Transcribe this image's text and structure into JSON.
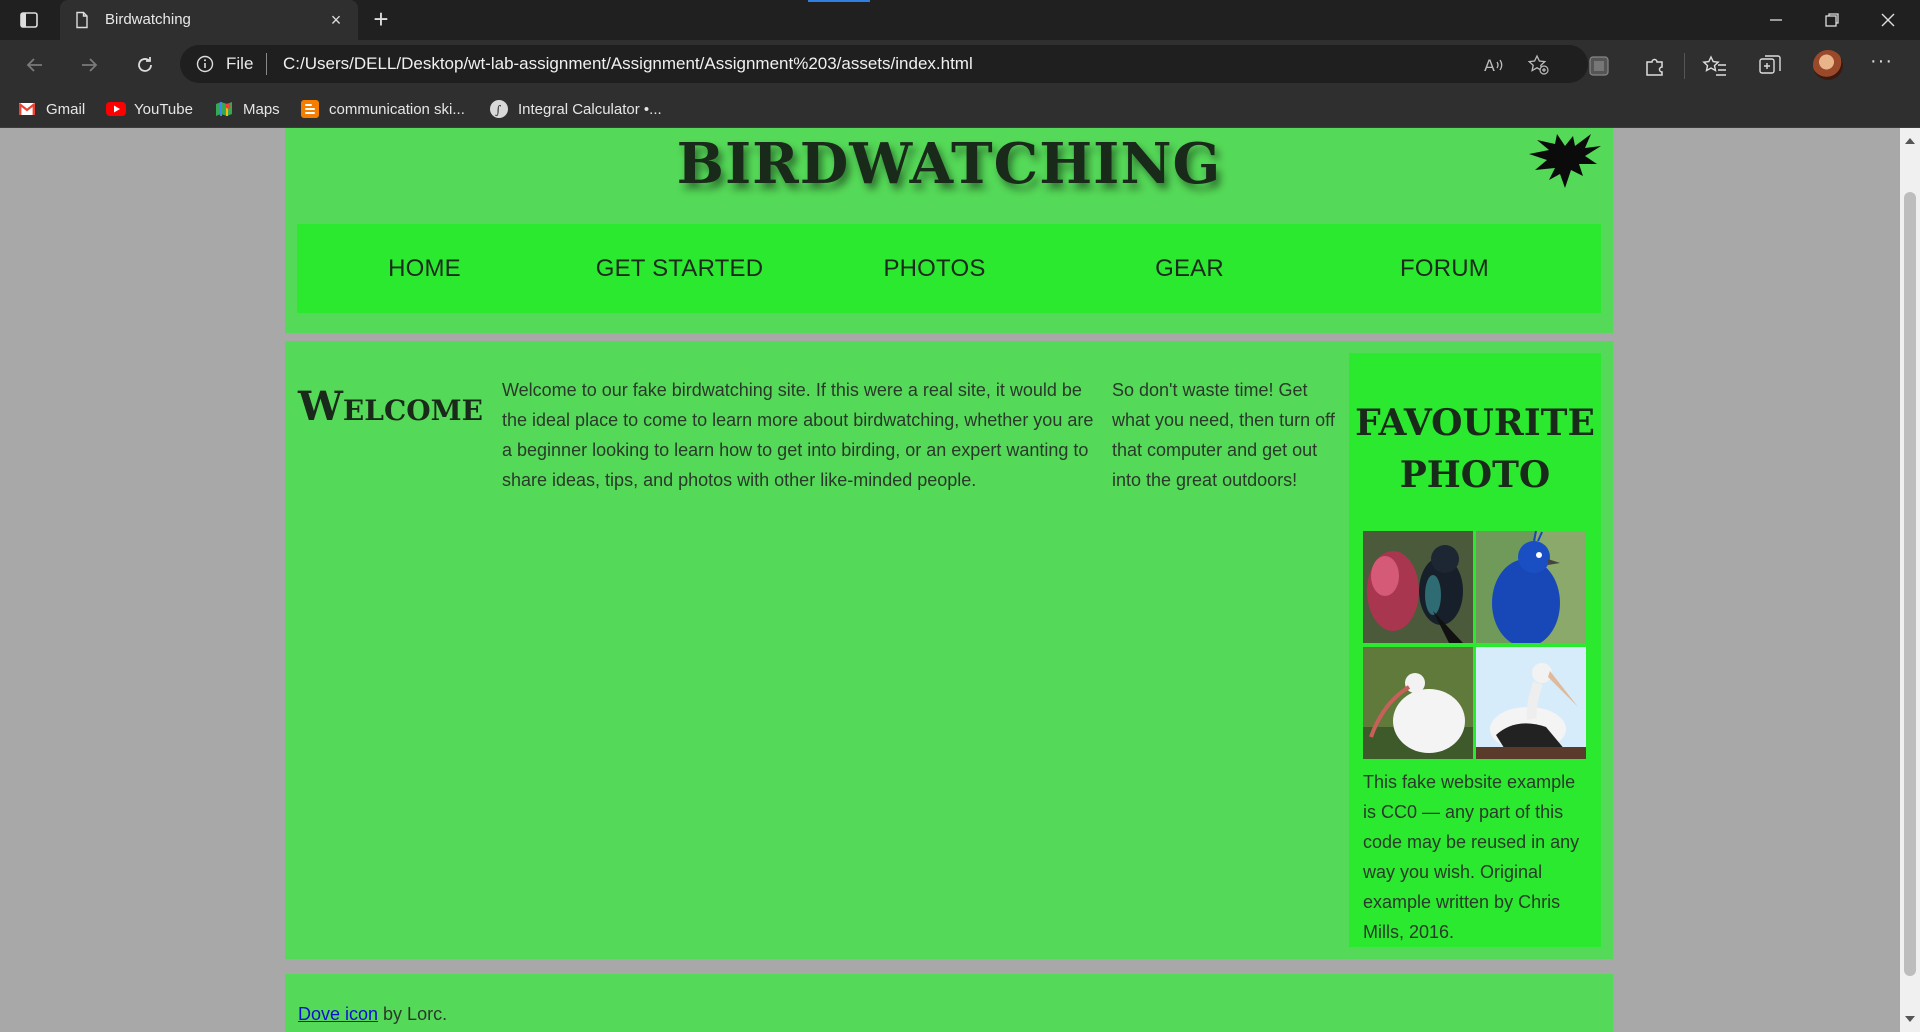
{
  "browser": {
    "tab_title": "Birdwatching",
    "address_scheme": "File",
    "url": "C:/Users/DELL/Desktop/wt-lab-assignment/Assignment/Assignment%203/assets/index.html",
    "bookmarks": [
      {
        "label": "Gmail",
        "icon": "gmail-icon",
        "color": "#ea4335"
      },
      {
        "label": "YouTube",
        "icon": "youtube-icon",
        "color": "#ff0000"
      },
      {
        "label": "Maps",
        "icon": "maps-icon",
        "color": "#34a853"
      },
      {
        "label": "communication ski...",
        "icon": "blogger-icon",
        "color": "#f57d00"
      },
      {
        "label": "Integral Calculator •...",
        "icon": "calculator-icon",
        "color": "#cccccc"
      }
    ]
  },
  "site": {
    "title": "BIRDWATCHING",
    "nav": [
      "HOME",
      "GET STARTED",
      "PHOTOS",
      "GEAR",
      "FORUM"
    ],
    "welcome_heading": "Welcome",
    "intro_text": "Welcome to our fake birdwatching site. If this were a real site, it would be the ideal place to come to learn more about birdwatching, whether you are a beginner looking to learn how to get into birding, or an expert wanting to share ideas, tips, and photos with other like-minded people.",
    "cta_text": "So don't waste time! Get what you need, then turn off that computer and get out into the great outdoors!",
    "aside_heading": "FAVOURITE PHOTO",
    "aside_text": "This fake website example is CC0 — any part of this code may be reused in any way you wish. Original example written by Chris Mills, 2016.",
    "footer_link": "Dove icon",
    "footer_suffix": " by Lorc."
  },
  "colors": {
    "page_bg": "#a8a8a8",
    "panel_green": "#55d958",
    "nav_green": "#2ae92e",
    "chrome_dark": "#202020"
  }
}
